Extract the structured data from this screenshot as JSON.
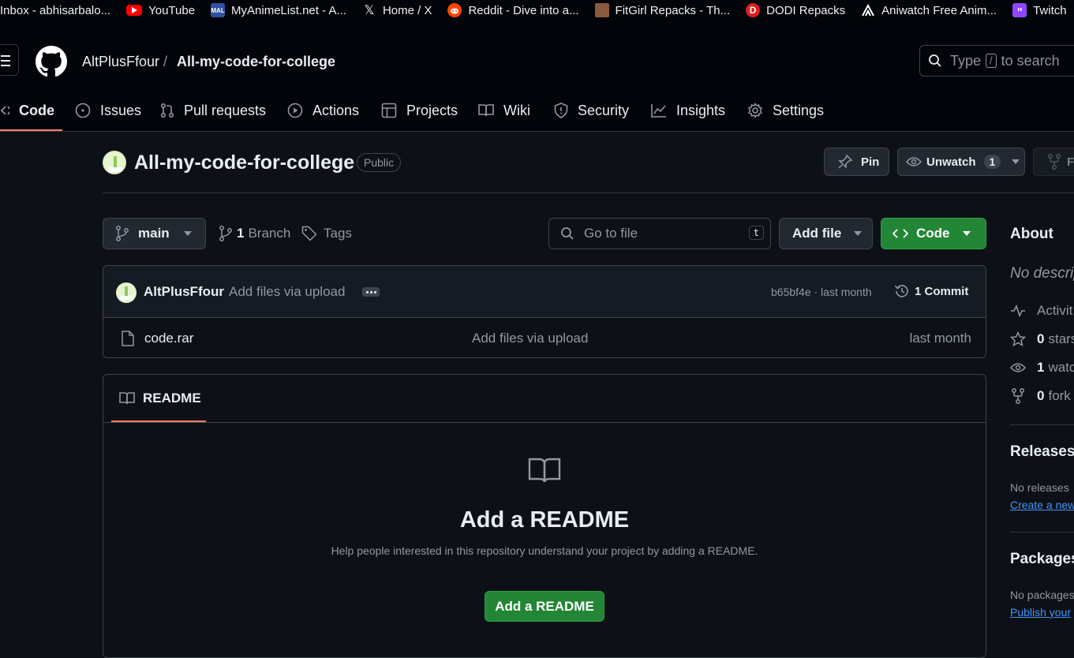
{
  "bookmarks": [
    {
      "label": "Inbox - abhisarbalo...",
      "icon": "gmail-icon",
      "color": ""
    },
    {
      "label": "YouTube",
      "icon": "youtube-icon",
      "color": "#ff0000"
    },
    {
      "label": "MyAnimeList.net - A...",
      "icon": "mal-icon",
      "color": "#2e51a2"
    },
    {
      "label": "Home / X",
      "icon": "x-icon",
      "color": ""
    },
    {
      "label": "Reddit - Dive into a...",
      "icon": "reddit-icon",
      "color": "#ff4500"
    },
    {
      "label": "FitGirl Repacks - Th...",
      "icon": "fitgirl-icon",
      "color": "#8a5a3c"
    },
    {
      "label": "DODI Repacks",
      "icon": "dodi-icon",
      "color": "#e01e1e"
    },
    {
      "label": "Aniwatch Free Anim...",
      "icon": "aniwatch-icon",
      "color": ""
    },
    {
      "label": "Twitch",
      "icon": "twitch-icon",
      "color": "#9146ff"
    },
    {
      "label": "",
      "icon": "gmail-m-icon",
      "color": "#d0e4f7"
    }
  ],
  "header": {
    "owner": "AltPlusFfour",
    "separator": "/",
    "repo": "All-my-code-for-college",
    "search": {
      "prefix": "Type",
      "key": "/",
      "suffix": "to search"
    }
  },
  "tabs": [
    {
      "label": "Code",
      "icon": "code-icon",
      "active": true
    },
    {
      "label": "Issues",
      "icon": "issue-icon"
    },
    {
      "label": "Pull requests",
      "icon": "pull-request-icon"
    },
    {
      "label": "Actions",
      "icon": "play-icon"
    },
    {
      "label": "Projects",
      "icon": "table-icon"
    },
    {
      "label": "Wiki",
      "icon": "book-icon"
    },
    {
      "label": "Security",
      "icon": "shield-icon"
    },
    {
      "label": "Insights",
      "icon": "graph-icon"
    },
    {
      "label": "Settings",
      "icon": "gear-icon"
    }
  ],
  "repo": {
    "title": "All-my-code-for-college",
    "visibility": "Public",
    "pin_label": "Pin",
    "unwatch_label": "Unwatch",
    "watch_count": "1",
    "fork_label": "F"
  },
  "branch": {
    "name": "main",
    "branch_count": "1",
    "branch_label": "Branch",
    "tags_label": "Tags",
    "goto_placeholder": "Go to file",
    "goto_key": "t",
    "add_file_label": "Add file",
    "code_label": "Code"
  },
  "commit": {
    "author": "AltPlusFfour",
    "message": "Add files via upload",
    "hash_time": "b65bf4e · last month",
    "count_label": "1 Commit"
  },
  "files": [
    {
      "name": "code.rar",
      "message": "Add files via upload",
      "time": "last month"
    }
  ],
  "readme": {
    "tab_label": "README",
    "heading": "Add a README",
    "help": "Help people interested in this repository understand your project by adding a README.",
    "button": "Add a README"
  },
  "sidebar": {
    "about_title": "About",
    "description": "No descrip",
    "activity": "Activit",
    "stars_count": "0",
    "stars_label": "stars",
    "watch_count": "1",
    "watch_label": "watc",
    "forks_count": "0",
    "forks_label": "fork",
    "releases_title": "Releases",
    "releases_text": "No releases",
    "releases_link": "Create a new",
    "packages_title": "Packages",
    "packages_text": "No packages",
    "packages_link": "Publish your"
  },
  "colors": {
    "bg": "#0d1117",
    "header_bg": "#010409",
    "accent_tab": "#f78166",
    "primary_green": "#238636",
    "link": "#4493f8"
  }
}
